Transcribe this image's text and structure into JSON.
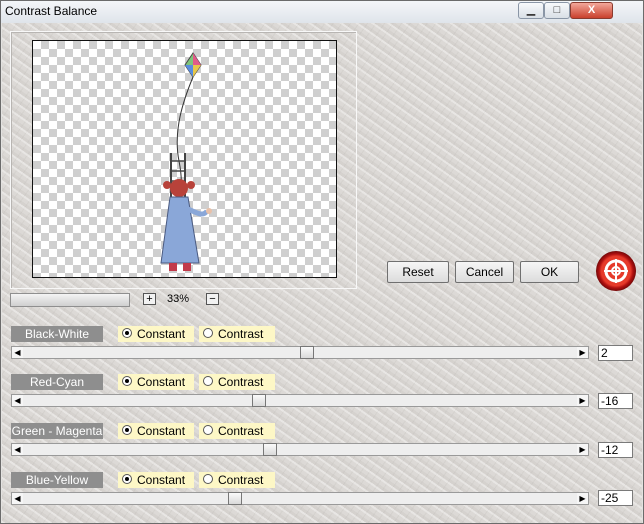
{
  "window": {
    "title": "Contrast Balance"
  },
  "titlebar_buttons": {
    "minimize": "▁",
    "maximize": "□",
    "close": "X"
  },
  "zoom": {
    "value": "33%",
    "plus": "+",
    "minus": "−"
  },
  "buttons": {
    "reset": "Reset",
    "cancel": "Cancel",
    "ok": "OK"
  },
  "rows": [
    {
      "label": "Black-White",
      "constant": "Constant",
      "contrast": "Contrast",
      "selected": "constant",
      "value": "2"
    },
    {
      "label": "Red-Cyan",
      "constant": "Constant",
      "contrast": "Contrast",
      "selected": "constant",
      "value": "-16"
    },
    {
      "label": "Green - Magenta",
      "constant": "Constant",
      "contrast": "Contrast",
      "selected": "constant",
      "value": "-12"
    },
    {
      "label": "Blue-Yellow",
      "constant": "Constant",
      "contrast": "Contrast",
      "selected": "constant",
      "value": "-25"
    }
  ],
  "arrows": {
    "left": "◀",
    "right": "▶"
  },
  "icons": {
    "logo": "lifebuoy-crosshair-icon"
  },
  "colors": {
    "logo_red": "#e63a2a",
    "radio_bg": "#fdf7c6",
    "label_bg": "#8e8e8e"
  }
}
